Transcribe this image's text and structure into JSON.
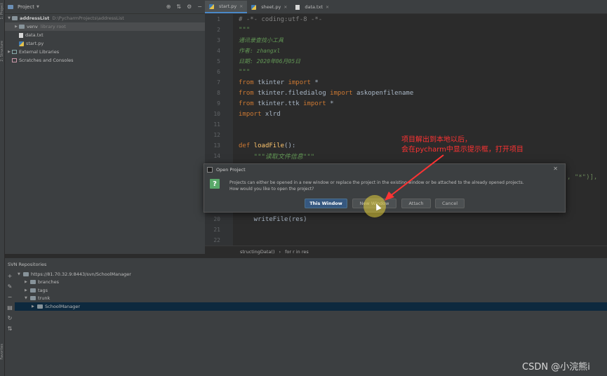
{
  "left_strip": {
    "labels": [
      "1: Project",
      "2: Structure",
      "Favorites"
    ]
  },
  "project": {
    "header_title": "Project",
    "tree": [
      {
        "name": "addressList",
        "extra": "D:\\PycharmProjects\\addressList"
      },
      {
        "name": "venv",
        "extra": "library root"
      },
      {
        "name": "data.txt"
      },
      {
        "name": "start.py"
      },
      {
        "name": "External Libraries"
      },
      {
        "name": "Scratches and Consoles"
      }
    ]
  },
  "editor": {
    "tabs": [
      {
        "label": "start.py"
      },
      {
        "label": "sheet.py"
      },
      {
        "label": "data.txt"
      }
    ],
    "lines": [
      {
        "n": "1",
        "text": "# -*- coding:utf-8 -*-"
      },
      {
        "n": "2",
        "text": "\"\"\""
      },
      {
        "n": "3",
        "text": "通讯录查找小工具"
      },
      {
        "n": "4",
        "text": "作者: zhangxl"
      },
      {
        "n": "5",
        "text": "日期: 2020年06月05日"
      },
      {
        "n": "6",
        "text": "\"\"\""
      },
      {
        "n": "7",
        "kw1": "from",
        "mid": " tkinter ",
        "kw2": "import",
        "tail": " *"
      },
      {
        "n": "8",
        "kw1": "from",
        "mid": " tkinter.filedialog ",
        "kw2": "import",
        "tail": " askopenfilename"
      },
      {
        "n": "9",
        "kw1": "from",
        "mid": " tkinter.ttk ",
        "kw2": "import",
        "tail": " *"
      },
      {
        "n": "10",
        "kw1": "import",
        "mid": " xlrd"
      },
      {
        "n": "11"
      },
      {
        "n": "12"
      },
      {
        "n": "13",
        "kw1": "def",
        "fn": " loadFile",
        "tail": "():"
      },
      {
        "n": "14",
        "text": "    \"\"\"读取文件信息\"\"\""
      },
      {
        "n": "20",
        "text": "    writeFile(res)"
      },
      {
        "n": "21"
      },
      {
        "n": "22"
      }
    ],
    "partial_right": ", \"*\")],",
    "breadcrumbs": [
      "structingData()",
      "for r in res"
    ]
  },
  "svn": {
    "header": "SVN Repositories",
    "tree": [
      {
        "label": "https://81.70.32.9:8443/svn/SchoolManager"
      },
      {
        "label": "branches"
      },
      {
        "label": "tags"
      },
      {
        "label": "trunk"
      },
      {
        "label": "SchoolManager"
      }
    ]
  },
  "dialog": {
    "title": "Open Project",
    "message_line1": "Projects can either be opened in a new window or replace the project in the existing window or be attached to the already opened projects.",
    "message_line2": "How would you like to open the project?",
    "buttons": {
      "this_window": "This Window",
      "new_window": "New Window",
      "attach": "Attach",
      "cancel": "Cancel"
    }
  },
  "annotation": {
    "line1": "项目解出到本地以后，",
    "line2": "会在pycharm中显示提示框，打开项目"
  },
  "watermark": "CSDN @小浣熊i",
  "colors": {
    "accent": "#365880",
    "annotation": "#ff3333",
    "comment": "#629755",
    "keyword": "#cc7832"
  }
}
